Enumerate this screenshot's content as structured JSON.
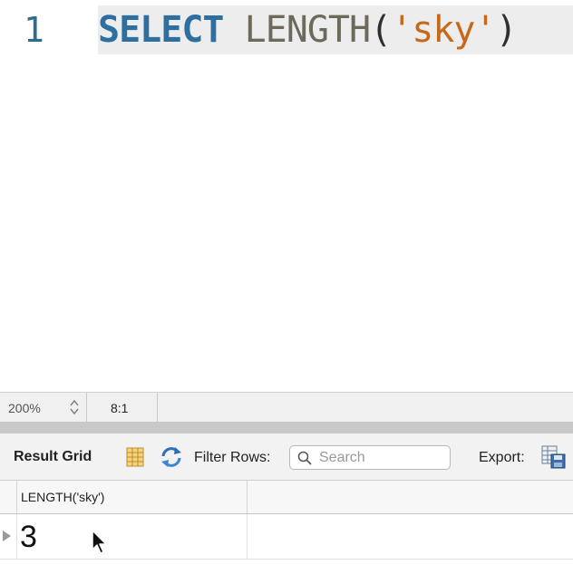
{
  "editor": {
    "line_number": "1",
    "code": {
      "keyword": "SELECT",
      "function": "LENGTH",
      "open_paren": "(",
      "string_literal": "'sky'",
      "close_paren": ")"
    }
  },
  "status_bar": {
    "zoom": "200%",
    "cursor_position": "8:1"
  },
  "toolbar": {
    "result_grid_label": "Result Grid",
    "filter_rows_label": "Filter Rows:",
    "search_placeholder": "Search",
    "search_value": "",
    "export_label": "Export:",
    "icons": [
      "grid-view-icon",
      "refresh-icon",
      "search-icon",
      "export-icon"
    ]
  },
  "grid": {
    "columns": [
      "LENGTH('sky')"
    ],
    "rows": [
      [
        "3"
      ]
    ]
  },
  "colors": {
    "keyword": "#2f6fa0",
    "function": "#6d6a5c",
    "string": "#c7691a",
    "line_number": "#2b6d8a",
    "current_line": "#ededed"
  }
}
